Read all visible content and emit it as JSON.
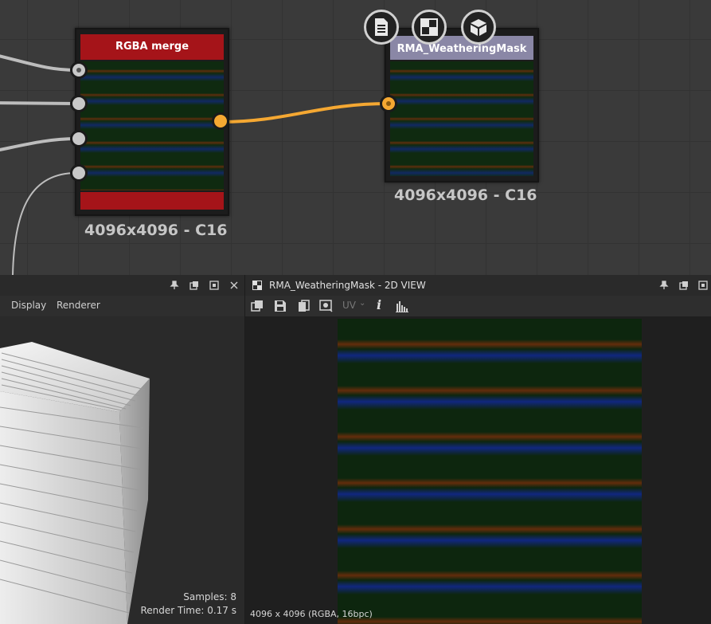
{
  "graph": {
    "rgba_node": {
      "title": "RGBA merge",
      "resolution": "4096x4096 - C16"
    },
    "mask_node": {
      "title": "RMA_WeatheringMask",
      "resolution": "4096x4096 - C16"
    },
    "node_actions": [
      {
        "name": "document-icon"
      },
      {
        "name": "checker-icon"
      },
      {
        "name": "cube-icon"
      }
    ]
  },
  "panel3d": {
    "menus": [
      "Display",
      "Renderer"
    ],
    "samples": "Samples: 8",
    "render_time": "Render Time: 0.17 s"
  },
  "panel2d": {
    "title": "RMA_WeatheringMask - 2D VIEW",
    "uv_label": "UV",
    "status": "4096 x 4096 (RGBA, 16bpc)"
  },
  "colors": {
    "accent": "#f5a832",
    "rgba_header": "#a51419",
    "mask_header": "#8a87a6"
  }
}
